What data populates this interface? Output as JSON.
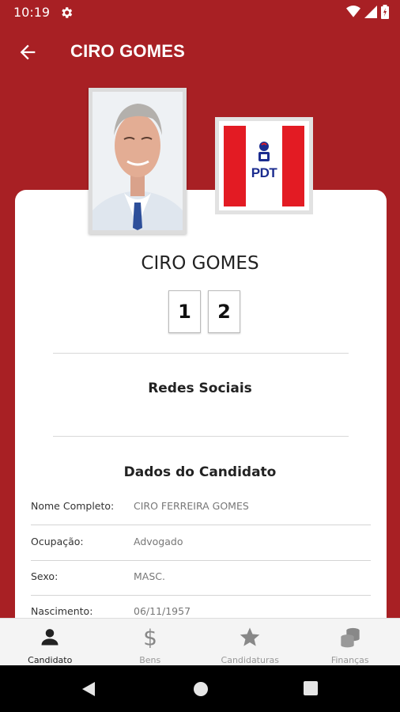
{
  "status_bar": {
    "time": "10:19"
  },
  "app_bar": {
    "title": "CIRO GOMES"
  },
  "candidate": {
    "name": "CIRO GOMES",
    "number_digits": [
      "1",
      "2"
    ],
    "party_logo_text": "PDT"
  },
  "sections": {
    "social": "Redes Sociais",
    "data": "Dados do Candidato"
  },
  "candidate_data": [
    {
      "label": "Nome Completo:",
      "value": "CIRO FERREIRA GOMES"
    },
    {
      "label": "Ocupação:",
      "value": "Advogado"
    },
    {
      "label": "Sexo:",
      "value": "MASC."
    },
    {
      "label": "Nascimento:",
      "value": "06/11/1957"
    }
  ],
  "bottom_nav": [
    {
      "label": "Candidato",
      "icon": "person-icon",
      "active": true
    },
    {
      "label": "Bens",
      "icon": "dollar-icon",
      "active": false
    },
    {
      "label": "Candidaturas",
      "icon": "star-icon",
      "active": false
    },
    {
      "label": "Finanças",
      "icon": "coins-icon",
      "active": false
    }
  ],
  "colors": {
    "primary": "#a82024",
    "party_red": "#e31b23",
    "party_blue": "#1b2c8f"
  }
}
